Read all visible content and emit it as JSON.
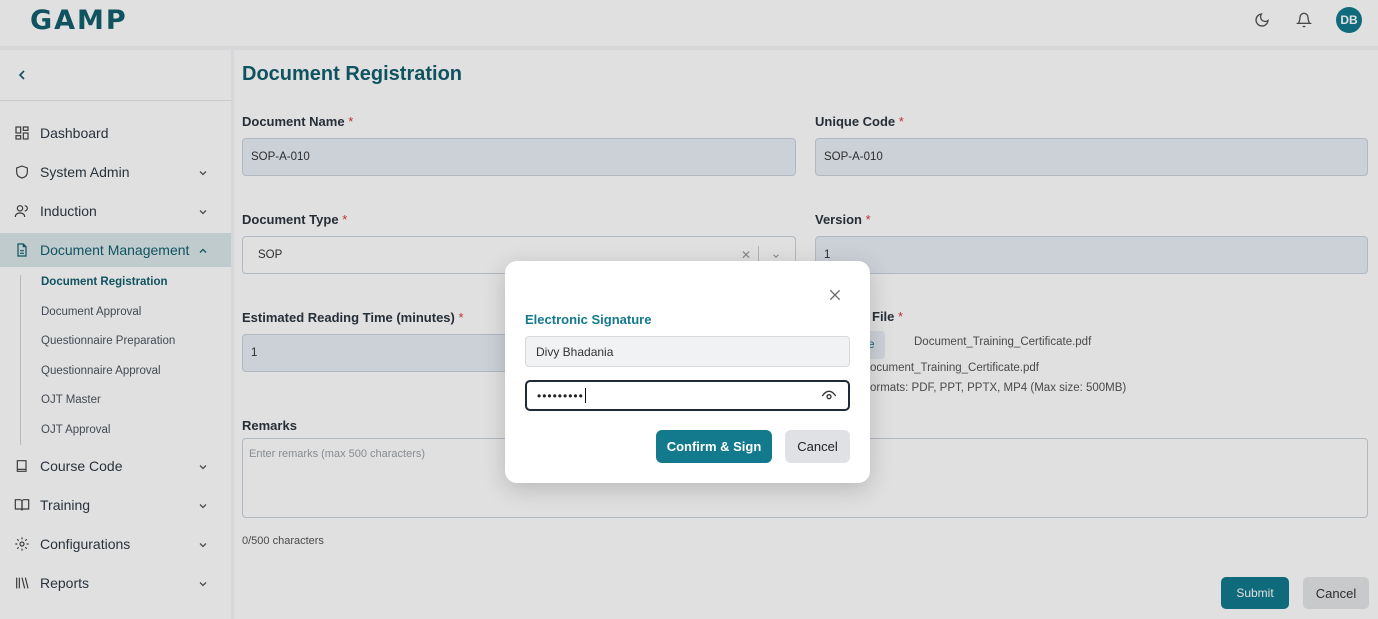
{
  "header": {
    "logo_text": "GAMP",
    "avatar_initials": "DB",
    "icons": [
      "moon-icon",
      "bell-icon"
    ]
  },
  "sidebar": {
    "items": [
      {
        "label": "Dashboard",
        "icon": "grid-icon"
      },
      {
        "label": "System Admin",
        "icon": "shield-icon"
      },
      {
        "label": "Induction",
        "icon": "users-icon"
      },
      {
        "label": "Document Management",
        "icon": "document-icon"
      },
      {
        "label": "Course Code",
        "icon": "book-icon"
      },
      {
        "label": "Training",
        "icon": "open-book-icon"
      },
      {
        "label": "Configurations",
        "icon": "gear-icon"
      },
      {
        "label": "Reports",
        "icon": "library-icon"
      }
    ],
    "sub_items": [
      "Document Registration",
      "Document Approval",
      "Questionnaire Preparation",
      "Questionnaire Approval",
      "OJT Master",
      "OJT Approval"
    ]
  },
  "form": {
    "title": "Document Registration",
    "document_name_label": "Document Name",
    "document_name_value": "SOP-A-010",
    "unique_code_label": "Unique Code",
    "unique_code_value": "SOP-A-010",
    "document_type_label": "Document Type",
    "document_type_value": "SOP",
    "version_label": "Version",
    "version_value": "1",
    "reading_time_label": "Estimated Reading Time (minutes)",
    "reading_time_value": "1",
    "file_label_partial": "File",
    "file_button_partial": "File",
    "file_chosen_name": "Document_Training_Certificate.pdf",
    "file_current_partial": "ocument_Training_Certificate.pdf",
    "file_formats_partial": "ormats: PDF, PPT, PPTX, MP4 (Max size: 500MB)",
    "remarks_label": "Remarks",
    "remarks_placeholder": "Enter remarks (max 500 characters)",
    "char_count": "0/500 characters",
    "required_mark": "*",
    "submit_label": "Submit",
    "cancel_label": "Cancel"
  },
  "modal": {
    "title": "Electronic Signature",
    "name_value": "Divy Bhadania",
    "password_masked": "•••••••••",
    "confirm_label": "Confirm & Sign",
    "cancel_label": "Cancel"
  },
  "colors": {
    "primary": "#127a8c",
    "title": "#125f6e",
    "required": "#d23b3b"
  }
}
